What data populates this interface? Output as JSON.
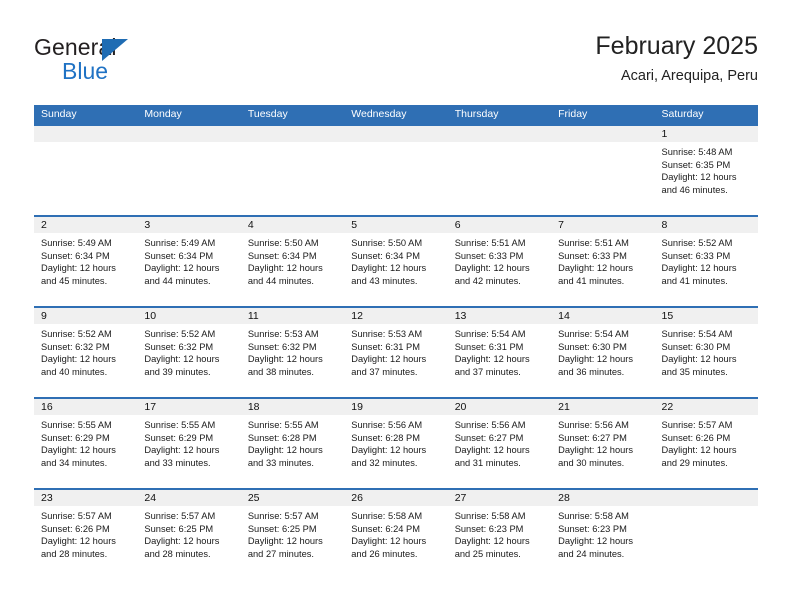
{
  "brand": {
    "name_top": "General",
    "name_bottom": "Blue",
    "triangle_color": "#1f6cb3",
    "text_color_top": "#231f20",
    "text_color_bottom": "#1f72c4"
  },
  "header": {
    "title": "February 2025",
    "subtitle": "Acari, Arequipa, Peru"
  },
  "theme": {
    "header_blue": "#2f6fb4",
    "daynum_band": "#f0f0f0",
    "cell_bg": "#ffffff",
    "text": "#1a1a1a"
  },
  "weekdays": [
    "Sunday",
    "Monday",
    "Tuesday",
    "Wednesday",
    "Thursday",
    "Friday",
    "Saturday"
  ],
  "weeks": [
    {
      "numbers": [
        "",
        "",
        "",
        "",
        "",
        "",
        "1"
      ],
      "cells": [
        {
          "sunrise": "",
          "sunset": "",
          "daylight": ""
        },
        {
          "sunrise": "",
          "sunset": "",
          "daylight": ""
        },
        {
          "sunrise": "",
          "sunset": "",
          "daylight": ""
        },
        {
          "sunrise": "",
          "sunset": "",
          "daylight": ""
        },
        {
          "sunrise": "",
          "sunset": "",
          "daylight": ""
        },
        {
          "sunrise": "",
          "sunset": "",
          "daylight": ""
        },
        {
          "sunrise": "Sunrise: 5:48 AM",
          "sunset": "Sunset: 6:35 PM",
          "daylight": "Daylight: 12 hours and 46 minutes."
        }
      ]
    },
    {
      "numbers": [
        "2",
        "3",
        "4",
        "5",
        "6",
        "7",
        "8"
      ],
      "cells": [
        {
          "sunrise": "Sunrise: 5:49 AM",
          "sunset": "Sunset: 6:34 PM",
          "daylight": "Daylight: 12 hours and 45 minutes."
        },
        {
          "sunrise": "Sunrise: 5:49 AM",
          "sunset": "Sunset: 6:34 PM",
          "daylight": "Daylight: 12 hours and 44 minutes."
        },
        {
          "sunrise": "Sunrise: 5:50 AM",
          "sunset": "Sunset: 6:34 PM",
          "daylight": "Daylight: 12 hours and 44 minutes."
        },
        {
          "sunrise": "Sunrise: 5:50 AM",
          "sunset": "Sunset: 6:34 PM",
          "daylight": "Daylight: 12 hours and 43 minutes."
        },
        {
          "sunrise": "Sunrise: 5:51 AM",
          "sunset": "Sunset: 6:33 PM",
          "daylight": "Daylight: 12 hours and 42 minutes."
        },
        {
          "sunrise": "Sunrise: 5:51 AM",
          "sunset": "Sunset: 6:33 PM",
          "daylight": "Daylight: 12 hours and 41 minutes."
        },
        {
          "sunrise": "Sunrise: 5:52 AM",
          "sunset": "Sunset: 6:33 PM",
          "daylight": "Daylight: 12 hours and 41 minutes."
        }
      ]
    },
    {
      "numbers": [
        "9",
        "10",
        "11",
        "12",
        "13",
        "14",
        "15"
      ],
      "cells": [
        {
          "sunrise": "Sunrise: 5:52 AM",
          "sunset": "Sunset: 6:32 PM",
          "daylight": "Daylight: 12 hours and 40 minutes."
        },
        {
          "sunrise": "Sunrise: 5:52 AM",
          "sunset": "Sunset: 6:32 PM",
          "daylight": "Daylight: 12 hours and 39 minutes."
        },
        {
          "sunrise": "Sunrise: 5:53 AM",
          "sunset": "Sunset: 6:32 PM",
          "daylight": "Daylight: 12 hours and 38 minutes."
        },
        {
          "sunrise": "Sunrise: 5:53 AM",
          "sunset": "Sunset: 6:31 PM",
          "daylight": "Daylight: 12 hours and 37 minutes."
        },
        {
          "sunrise": "Sunrise: 5:54 AM",
          "sunset": "Sunset: 6:31 PM",
          "daylight": "Daylight: 12 hours and 37 minutes."
        },
        {
          "sunrise": "Sunrise: 5:54 AM",
          "sunset": "Sunset: 6:30 PM",
          "daylight": "Daylight: 12 hours and 36 minutes."
        },
        {
          "sunrise": "Sunrise: 5:54 AM",
          "sunset": "Sunset: 6:30 PM",
          "daylight": "Daylight: 12 hours and 35 minutes."
        }
      ]
    },
    {
      "numbers": [
        "16",
        "17",
        "18",
        "19",
        "20",
        "21",
        "22"
      ],
      "cells": [
        {
          "sunrise": "Sunrise: 5:55 AM",
          "sunset": "Sunset: 6:29 PM",
          "daylight": "Daylight: 12 hours and 34 minutes."
        },
        {
          "sunrise": "Sunrise: 5:55 AM",
          "sunset": "Sunset: 6:29 PM",
          "daylight": "Daylight: 12 hours and 33 minutes."
        },
        {
          "sunrise": "Sunrise: 5:55 AM",
          "sunset": "Sunset: 6:28 PM",
          "daylight": "Daylight: 12 hours and 33 minutes."
        },
        {
          "sunrise": "Sunrise: 5:56 AM",
          "sunset": "Sunset: 6:28 PM",
          "daylight": "Daylight: 12 hours and 32 minutes."
        },
        {
          "sunrise": "Sunrise: 5:56 AM",
          "sunset": "Sunset: 6:27 PM",
          "daylight": "Daylight: 12 hours and 31 minutes."
        },
        {
          "sunrise": "Sunrise: 5:56 AM",
          "sunset": "Sunset: 6:27 PM",
          "daylight": "Daylight: 12 hours and 30 minutes."
        },
        {
          "sunrise": "Sunrise: 5:57 AM",
          "sunset": "Sunset: 6:26 PM",
          "daylight": "Daylight: 12 hours and 29 minutes."
        }
      ]
    },
    {
      "numbers": [
        "23",
        "24",
        "25",
        "26",
        "27",
        "28",
        ""
      ],
      "cells": [
        {
          "sunrise": "Sunrise: 5:57 AM",
          "sunset": "Sunset: 6:26 PM",
          "daylight": "Daylight: 12 hours and 28 minutes."
        },
        {
          "sunrise": "Sunrise: 5:57 AM",
          "sunset": "Sunset: 6:25 PM",
          "daylight": "Daylight: 12 hours and 28 minutes."
        },
        {
          "sunrise": "Sunrise: 5:57 AM",
          "sunset": "Sunset: 6:25 PM",
          "daylight": "Daylight: 12 hours and 27 minutes."
        },
        {
          "sunrise": "Sunrise: 5:58 AM",
          "sunset": "Sunset: 6:24 PM",
          "daylight": "Daylight: 12 hours and 26 minutes."
        },
        {
          "sunrise": "Sunrise: 5:58 AM",
          "sunset": "Sunset: 6:23 PM",
          "daylight": "Daylight: 12 hours and 25 minutes."
        },
        {
          "sunrise": "Sunrise: 5:58 AM",
          "sunset": "Sunset: 6:23 PM",
          "daylight": "Daylight: 12 hours and 24 minutes."
        },
        {
          "sunrise": "",
          "sunset": "",
          "daylight": ""
        }
      ]
    }
  ]
}
